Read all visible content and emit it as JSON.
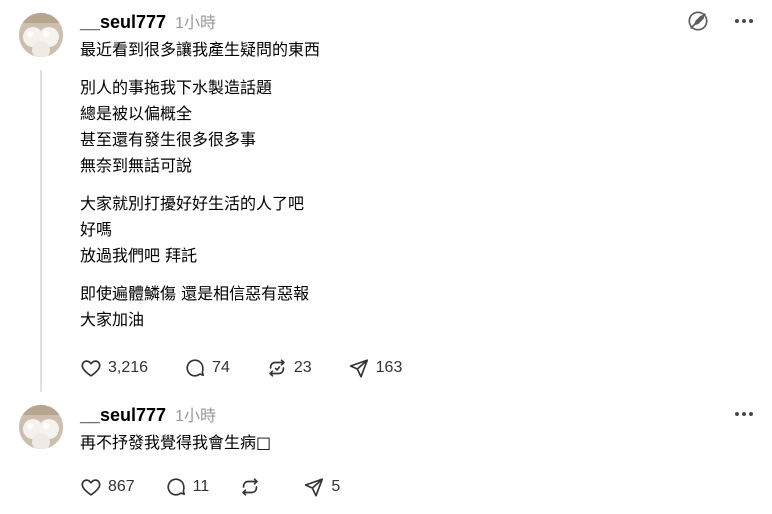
{
  "posts": [
    {
      "username": "__seul777",
      "time": "1小時",
      "paragraphs": [
        "最近看到很多讓我產生疑問的東西",
        "別人的事拖我下水製造話題\n總是被以偏概全\n甚至還有發生很多很多事\n無奈到無話可說",
        "大家就別打擾好好生活的人了吧\n好嗎\n放過我們吧 拜託",
        "即使遍體鱗傷 還是相信惡有惡報\n大家加油"
      ],
      "stats": {
        "likes": "3,216",
        "comments": "74",
        "reposts": "23",
        "shares": "163"
      }
    },
    {
      "username": "__seul777",
      "time": "1小時",
      "paragraphs": [
        "再不抒發我覺得我會生病□"
      ],
      "stats": {
        "likes": "867",
        "comments": "11",
        "reposts": "",
        "shares": "5"
      }
    }
  ],
  "icons": {
    "edit": "edit-off-icon",
    "more": "more-icon",
    "like": "heart-icon",
    "comment": "comment-icon",
    "repost": "repost-icon",
    "share": "send-icon"
  },
  "colors": {
    "text": "#000000",
    "muted": "#999999",
    "icon": "#4a4a4a",
    "thread_line": "#e0e0e0"
  }
}
